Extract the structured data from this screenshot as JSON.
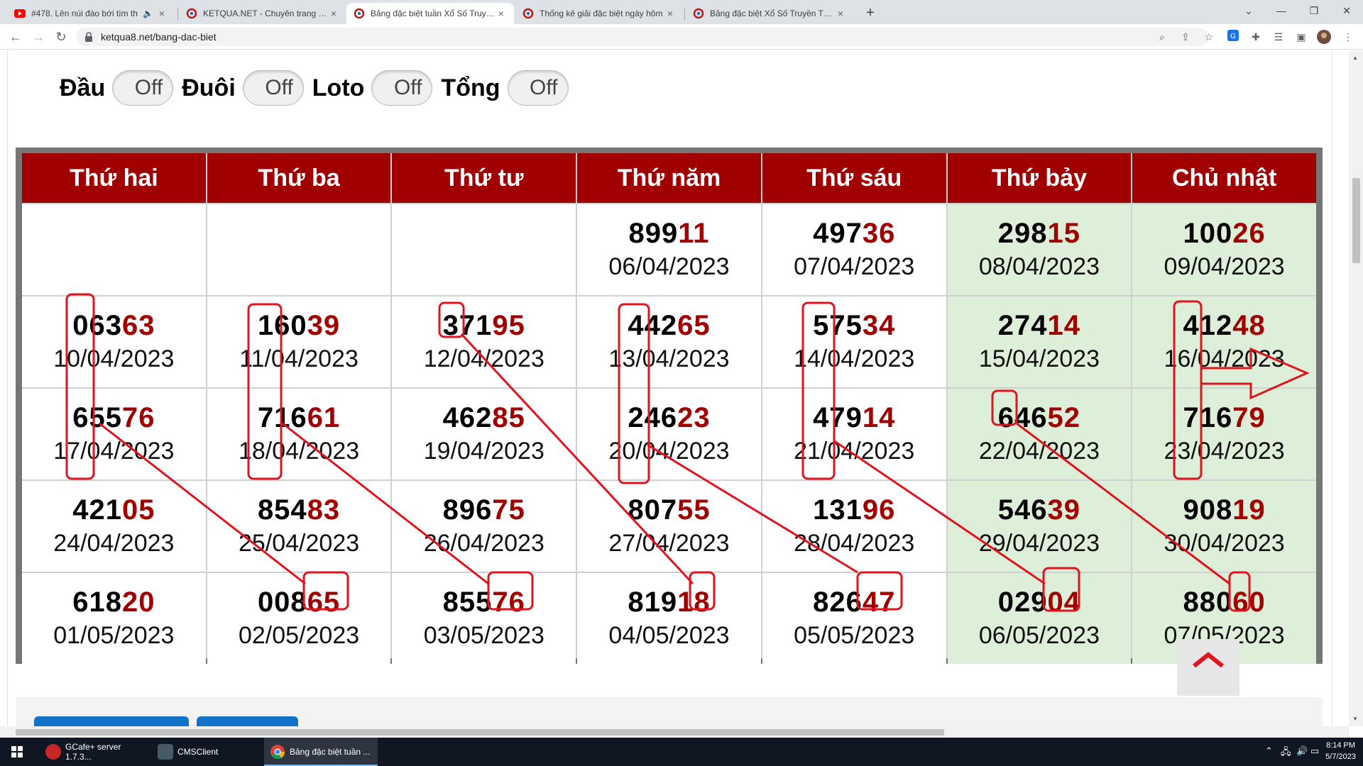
{
  "tabs": [
    {
      "title": "#478. Lên núi đào bới tìm th",
      "x": "×",
      "favicon": "youtube-icon",
      "audio": "speaker-icon"
    },
    {
      "title": "KETQUA.NET - Chuyên trang xổ s",
      "x": "×",
      "favicon": "ketqua-icon"
    },
    {
      "title": "Bảng đặc biệt tuần Xổ Số Truyền",
      "x": "×",
      "favicon": "ketqua-icon",
      "active": true
    },
    {
      "title": "Thống kê giải đặc biệt ngày hôm",
      "x": "×",
      "favicon": "ketqua-icon"
    },
    {
      "title": "Bảng đặc biệt Xổ Số Truyền Thốn",
      "x": "×",
      "favicon": "ketqua-icon"
    }
  ],
  "new_tab": "+",
  "window_controls": {
    "dropdown": "⌄",
    "minimize": "—",
    "maximize": "❐",
    "close": "✕"
  },
  "nav": {
    "back": "←",
    "forward": "→",
    "reload": "↻"
  },
  "address": {
    "url": "ketqua8.net/bang-dac-biet",
    "lock": "lock-icon"
  },
  "toolbar_icons": [
    "zoom-icon",
    "share-icon",
    "star-icon",
    "translate-icon",
    "extensions-icon",
    "reading-list-icon",
    "side-panel-icon",
    "profile-icon",
    "menu-icon"
  ],
  "filters": [
    {
      "label": "Đầu",
      "state": "Off"
    },
    {
      "label": "Đuôi",
      "state": "Off"
    },
    {
      "label": "Loto",
      "state": "Off"
    },
    {
      "label": "Tổng",
      "state": "Off"
    }
  ],
  "table": {
    "headers": [
      "Thứ hai",
      "Thứ ba",
      "Thứ tư",
      "Thứ năm",
      "Thứ sáu",
      "Thứ bảy",
      "Chủ nhật"
    ],
    "rows": [
      [
        {
          "lead": "",
          "tail": "",
          "date": ""
        },
        {
          "lead": "",
          "tail": "",
          "date": ""
        },
        {
          "lead": "",
          "tail": "",
          "date": ""
        },
        {
          "lead": "899",
          "tail": "11",
          "date": "06/04/2023"
        },
        {
          "lead": "497",
          "tail": "36",
          "date": "07/04/2023"
        },
        {
          "lead": "298",
          "tail": "15",
          "date": "08/04/2023"
        },
        {
          "lead": "100",
          "tail": "26",
          "date": "09/04/2023"
        }
      ],
      [
        {
          "lead": "063",
          "tail": "63",
          "date": "10/04/2023"
        },
        {
          "lead": "160",
          "tail": "39",
          "date": "11/04/2023"
        },
        {
          "lead": "371",
          "tail": "95",
          "date": "12/04/2023"
        },
        {
          "lead": "442",
          "tail": "65",
          "date": "13/04/2023"
        },
        {
          "lead": "575",
          "tail": "34",
          "date": "14/04/2023"
        },
        {
          "lead": "274",
          "tail": "14",
          "date": "15/04/2023"
        },
        {
          "lead": "412",
          "tail": "48",
          "date": "16/04/2023"
        }
      ],
      [
        {
          "lead": "655",
          "tail": "76",
          "date": "17/04/2023"
        },
        {
          "lead": "716",
          "tail": "61",
          "date": "18/04/2023"
        },
        {
          "lead": "462",
          "tail": "85",
          "date": "19/04/2023"
        },
        {
          "lead": "246",
          "tail": "23",
          "date": "20/04/2023"
        },
        {
          "lead": "479",
          "tail": "14",
          "date": "21/04/2023"
        },
        {
          "lead": "646",
          "tail": "52",
          "date": "22/04/2023"
        },
        {
          "lead": "716",
          "tail": "79",
          "date": "23/04/2023"
        }
      ],
      [
        {
          "lead": "421",
          "tail": "05",
          "date": "24/04/2023"
        },
        {
          "lead": "854",
          "tail": "83",
          "date": "25/04/2023"
        },
        {
          "lead": "896",
          "tail": "75",
          "date": "26/04/2023"
        },
        {
          "lead": "807",
          "tail": "55",
          "date": "27/04/2023"
        },
        {
          "lead": "131",
          "tail": "96",
          "date": "28/04/2023"
        },
        {
          "lead": "546",
          "tail": "39",
          "date": "29/04/2023"
        },
        {
          "lead": "908",
          "tail": "19",
          "date": "30/04/2023"
        }
      ],
      [
        {
          "lead": "618",
          "tail": "20",
          "date": "01/05/2023"
        },
        {
          "lead": "008",
          "tail": "65",
          "date": "02/05/2023"
        },
        {
          "lead": "855",
          "tail": "76",
          "date": "03/05/2023"
        },
        {
          "lead": "819",
          "tail": "18",
          "date": "04/05/2023"
        },
        {
          "lead": "826",
          "tail": "47",
          "date": "05/05/2023"
        },
        {
          "lead": "029",
          "tail": "04",
          "date": "06/05/2023"
        },
        {
          "lead": "880",
          "tail": "60",
          "date": "07/05/2023"
        }
      ]
    ]
  },
  "annotation_color": "#e0141e",
  "header_color": "#a10000",
  "weekend_color": "#ddefd8",
  "scroll_top_icon": "chevron-up-icon",
  "taskbar": {
    "start": "windows-icon",
    "apps": [
      {
        "label": "GCafe+ server 1.7.3...",
        "icon": "gcafe-icon"
      },
      {
        "label": "CMSClient",
        "icon": "cmsclient-icon"
      },
      {
        "label": "Bảng đặc biệt tuần ...",
        "icon": "chrome-icon",
        "active": true
      }
    ],
    "time": "8:14 PM",
    "date": "5/7/2023"
  }
}
